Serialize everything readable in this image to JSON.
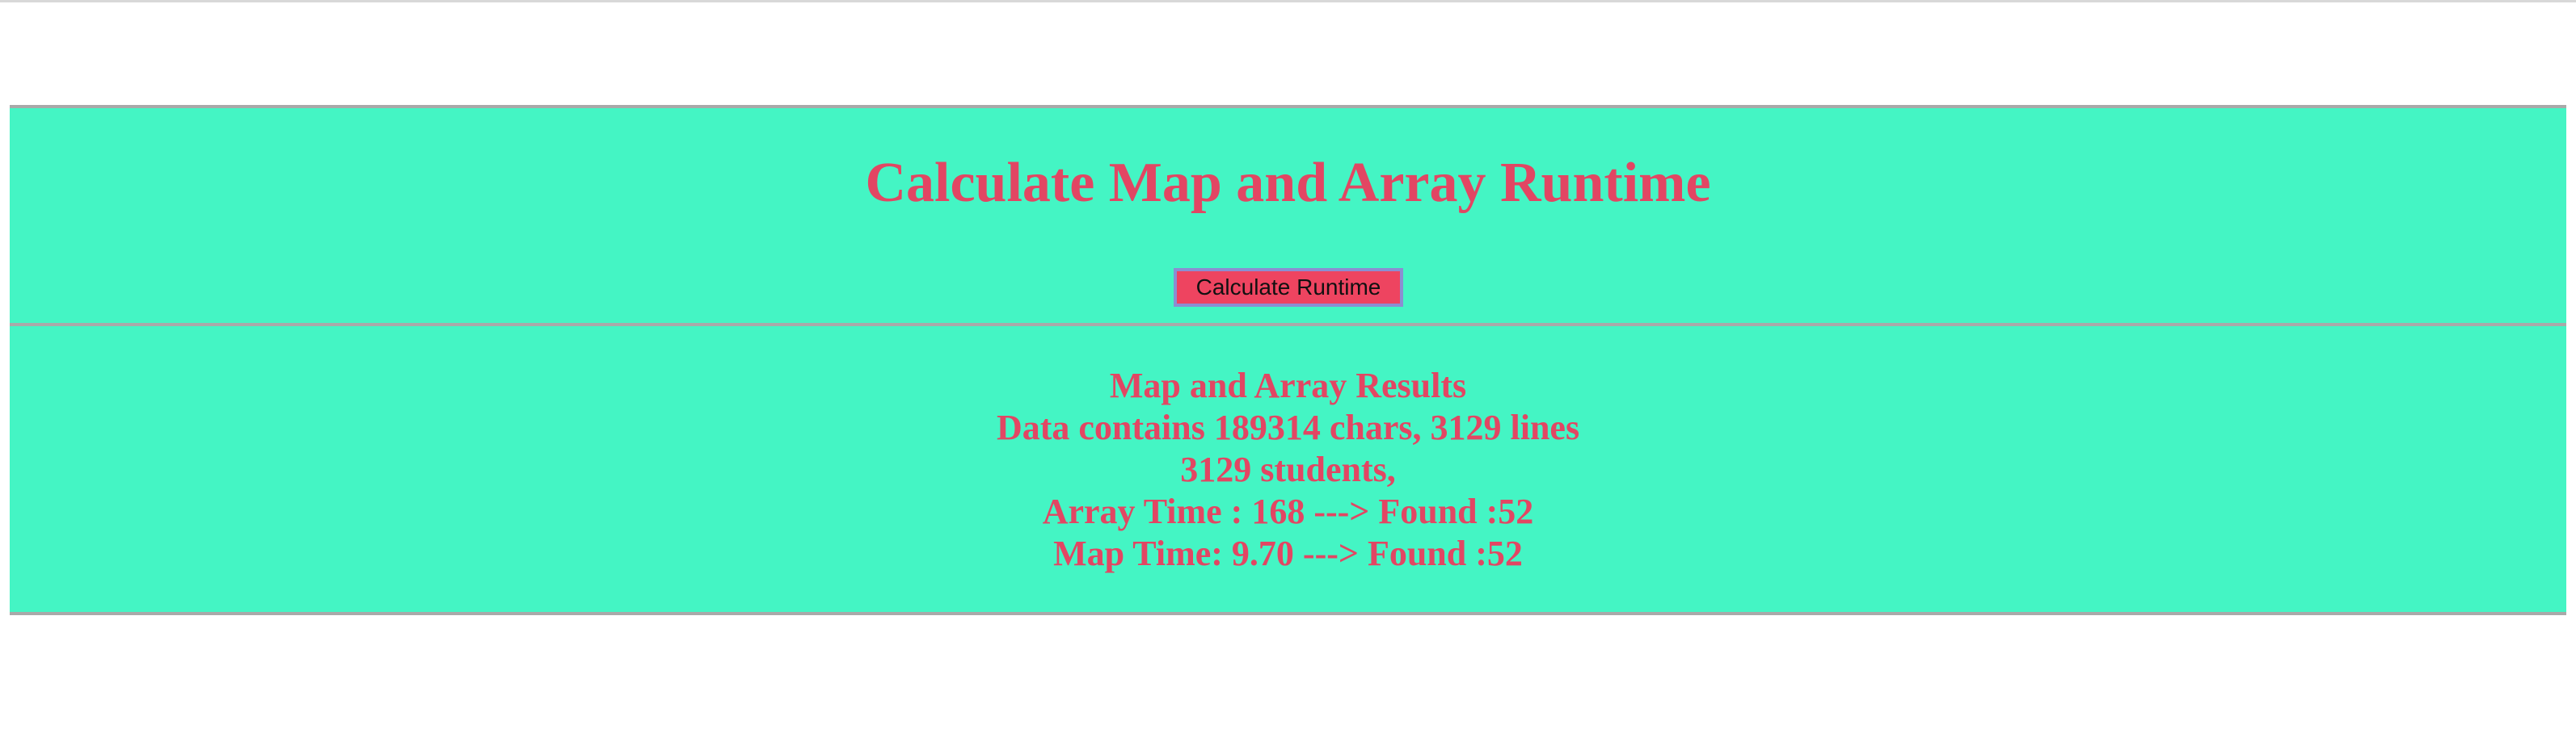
{
  "header": {
    "title": "Calculate Map and Array Runtime",
    "button_label": "Calculate Runtime"
  },
  "results": {
    "heading": "Map and Array Results",
    "data_line": "Data contains 189314 chars, 3129 lines",
    "students_line": "3129 students,",
    "array_line": "Array Time : 168 ---> Found :52",
    "map_line": "Map Time: 9.70 ---> Found :52"
  },
  "colors": {
    "panel_background": "#44f5c4",
    "text": "#e24663",
    "button_background": "#ee4460",
    "button_border": "#8a8fd2"
  }
}
